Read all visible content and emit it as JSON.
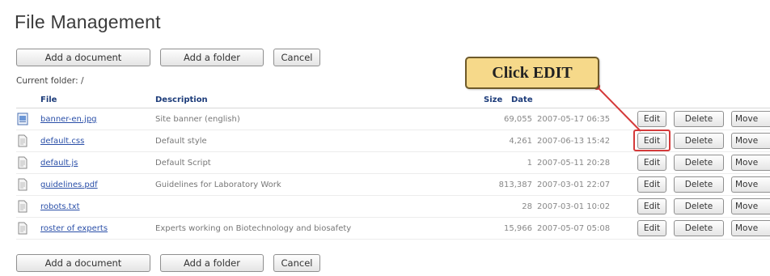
{
  "page": {
    "title": "File Management",
    "current_folder": "Current folder: /"
  },
  "toolbar_top": {
    "add_document": "Add a document",
    "add_folder": "Add a folder",
    "cancel": "Cancel"
  },
  "toolbar_bottom": {
    "add_document": "Add a document",
    "add_folder": "Add a folder",
    "cancel": "Cancel"
  },
  "table": {
    "headers": {
      "file": "File",
      "description": "Description",
      "size": "Size",
      "date": "Date"
    },
    "rows": [
      {
        "file": "banner-en.jpg",
        "description": "Site banner (english)",
        "size": "69,055",
        "date": "2007-05-17 06:35",
        "icon": "image-file-icon"
      },
      {
        "file": "default.css",
        "description": "Default style",
        "size": "4,261",
        "date": "2007-06-13 15:42",
        "icon": "document-file-icon"
      },
      {
        "file": "default.js",
        "description": "Default Script",
        "size": "1",
        "date": "2007-05-11 20:28",
        "icon": "document-file-icon"
      },
      {
        "file": "guidelines.pdf",
        "description": "Guidelines for Laboratory Work",
        "size": "813,387",
        "date": "2007-03-01 22:07",
        "icon": "document-file-icon"
      },
      {
        "file": "robots.txt",
        "description": "",
        "size": "28",
        "date": "2007-03-01 10:02",
        "icon": "document-file-icon"
      },
      {
        "file": "roster of experts",
        "description": "Experts working on Biotechnology and biosafety",
        "size": "15,966",
        "date": "2007-05-07 05:08",
        "icon": "document-file-icon"
      }
    ],
    "row_actions": {
      "edit": "Edit",
      "delete": "Delete",
      "move": "Move"
    }
  },
  "annotation": {
    "callout_text": "Click EDIT",
    "color": "#d43a3a",
    "callout_bg": "#f6d98a"
  }
}
